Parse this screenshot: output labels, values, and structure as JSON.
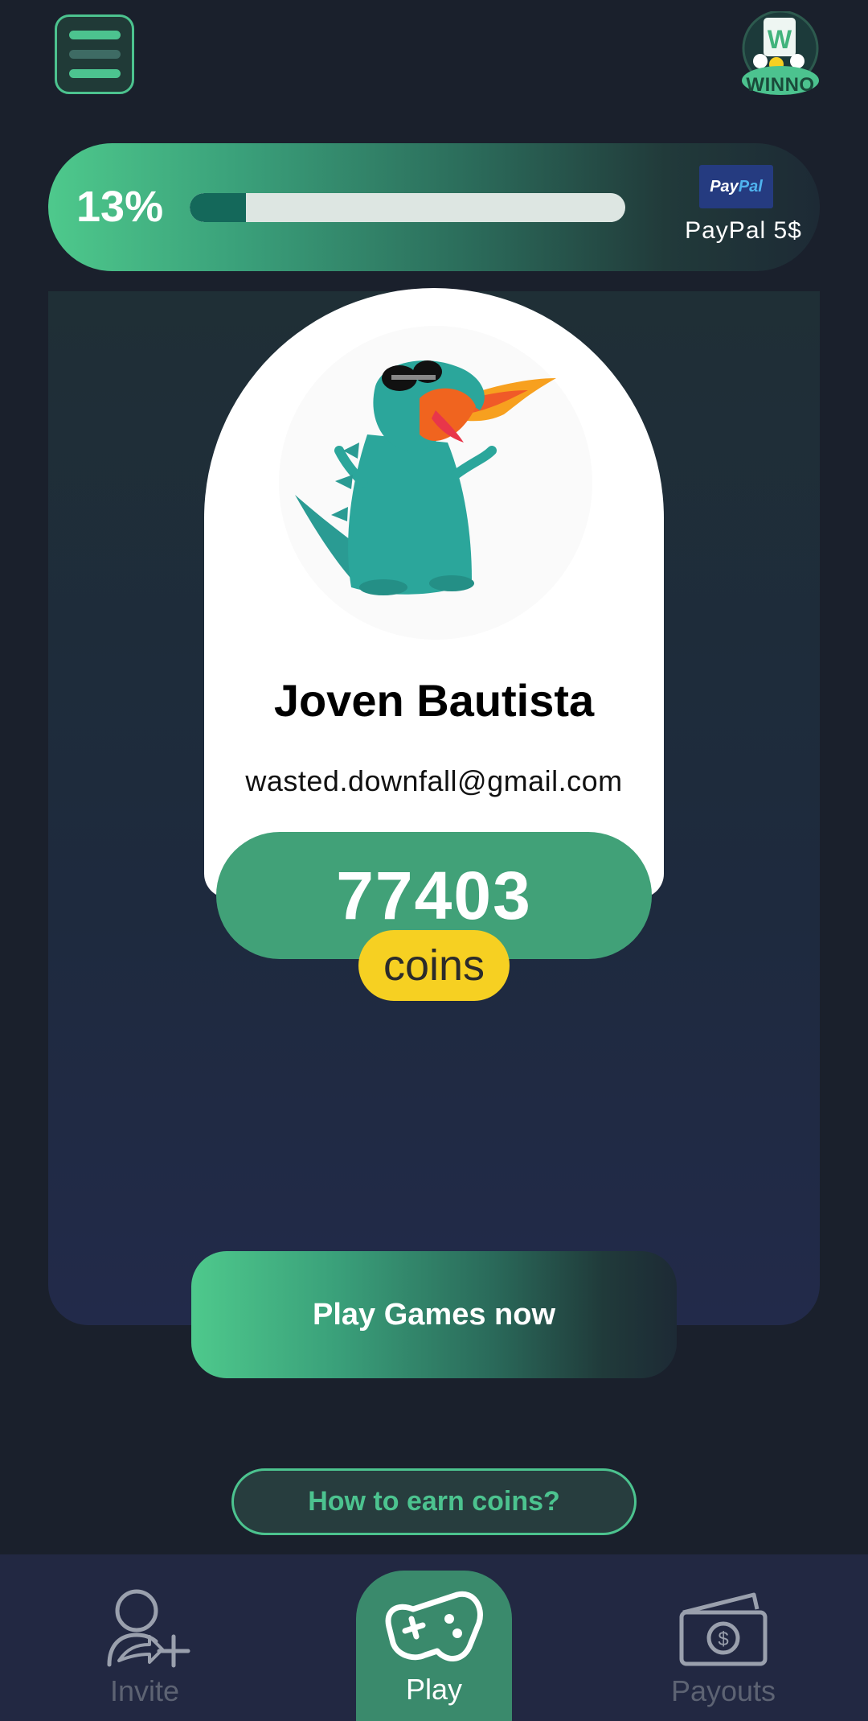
{
  "header": {
    "menu_icon": "hamburger-menu-icon",
    "logo_text": "WINNO"
  },
  "progress": {
    "percent_label": "13%",
    "percent_value": 0.13,
    "reward_brand": "PayPal",
    "reward_label": "PayPal 5$"
  },
  "profile": {
    "name": "Joven Bautista",
    "email": "wasted.downfall@gmail.com",
    "avatar_icon": "dinosaur-avatar-icon",
    "coins": "77403",
    "coins_unit": "coins"
  },
  "actions": {
    "play_label": "Play Games now",
    "earn_label": "How to earn coins?"
  },
  "nav": {
    "items": [
      {
        "label": "Invite",
        "icon": "invite-user-icon",
        "active": false
      },
      {
        "label": "Play",
        "icon": "gamepad-icon",
        "active": true
      },
      {
        "label": "Payouts",
        "icon": "wallet-icon",
        "active": false
      }
    ]
  },
  "colors": {
    "background": "#1a202c",
    "accent_green": "#4cc38f",
    "coin_pill": "#41a178",
    "coin_badge": "#f6d022",
    "progress_fill": "#14685a",
    "nav_background": "#222842"
  }
}
